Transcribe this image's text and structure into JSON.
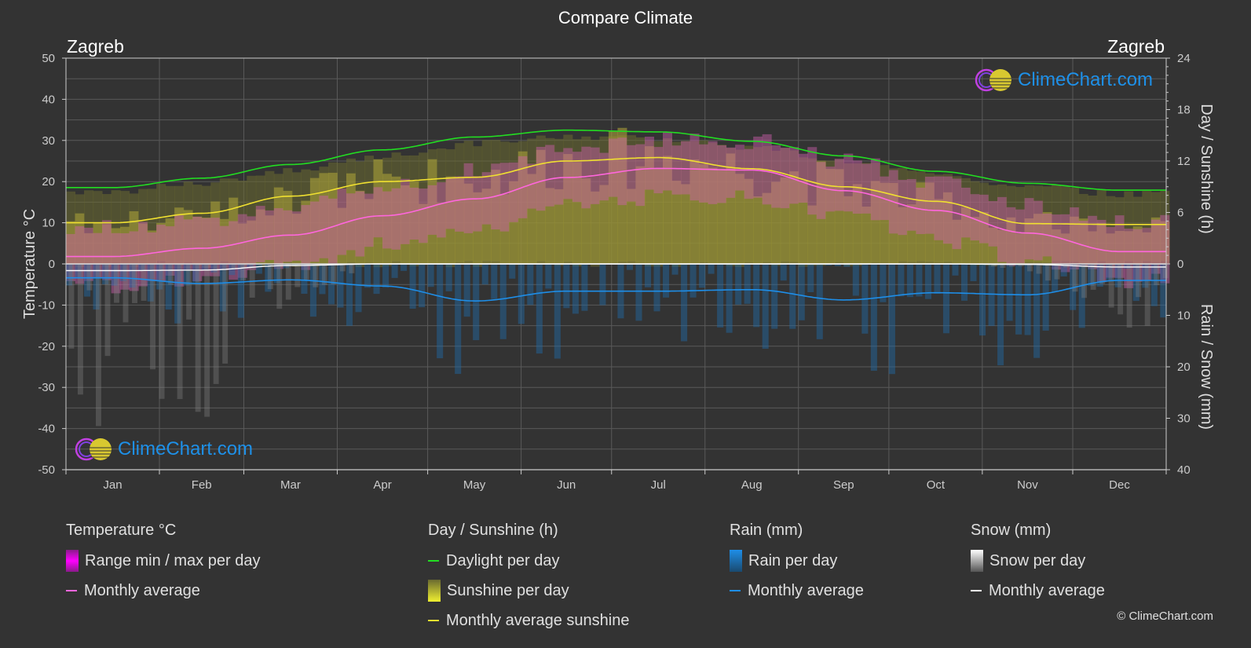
{
  "header": {
    "title": "Compare Climate",
    "city_left": "Zagreb",
    "city_right": "Zagreb"
  },
  "logo": {
    "text": "ClimeChart.com"
  },
  "copyright": "© ClimeChart.com",
  "legend": {
    "temperature": {
      "heading": "Temperature °C",
      "items": [
        {
          "label": "Range min / max per day",
          "kind": "bar",
          "color": "#e020e0"
        },
        {
          "label": "Monthly average",
          "kind": "line",
          "color": "#ff66dd"
        }
      ]
    },
    "sunshine": {
      "heading": "Day / Sunshine (h)",
      "items": [
        {
          "label": "Daylight per day",
          "kind": "line",
          "color": "#22dd22"
        },
        {
          "label": "Sunshine per day",
          "kind": "bar",
          "color": "#e0e030"
        },
        {
          "label": "Monthly average sunshine",
          "kind": "line",
          "color": "#f0e030"
        }
      ]
    },
    "rain": {
      "heading": "Rain (mm)",
      "items": [
        {
          "label": "Rain per day",
          "kind": "bar",
          "color": "#1e8ee8"
        },
        {
          "label": "Monthly average",
          "kind": "line",
          "color": "#1e8ee8"
        }
      ]
    },
    "snow": {
      "heading": "Snow (mm)",
      "items": [
        {
          "label": "Snow per day",
          "kind": "bar",
          "color": "#dddddd"
        },
        {
          "label": "Monthly average",
          "kind": "line",
          "color": "#ffffff"
        }
      ]
    }
  },
  "chart_data": {
    "type": "line",
    "title": "Compare Climate",
    "location": "Zagreb",
    "categories": [
      "Jan",
      "Feb",
      "Mar",
      "Apr",
      "May",
      "Jun",
      "Jul",
      "Aug",
      "Sep",
      "Oct",
      "Nov",
      "Dec"
    ],
    "axes": {
      "left": {
        "label": "Temperature °C",
        "range": [
          -50,
          50
        ],
        "ticks": [
          50,
          40,
          30,
          20,
          10,
          0,
          -10,
          -20,
          -30,
          -40,
          -50
        ]
      },
      "right_top": {
        "label": "Day / Sunshine (h)",
        "range": [
          0,
          24
        ],
        "ticks": [
          24,
          18,
          12,
          6,
          0
        ]
      },
      "right_bottom": {
        "label": "Rain / Snow (mm)",
        "range": [
          0,
          40
        ],
        "ticks": [
          0,
          10,
          20,
          30,
          40
        ]
      }
    },
    "grid": true,
    "series": [
      {
        "name": "Temperature monthly average",
        "unit": "°C",
        "color": "#ff66dd",
        "values": [
          1.8,
          3.8,
          7.0,
          11.7,
          15.8,
          21.0,
          23.2,
          22.8,
          17.8,
          13.0,
          7.5,
          3.0
        ]
      },
      {
        "name": "Daylight per day",
        "unit": "h",
        "color": "#22dd22",
        "values": [
          8.9,
          10.0,
          11.6,
          13.3,
          14.8,
          15.6,
          15.4,
          14.3,
          12.6,
          10.8,
          9.4,
          8.6
        ]
      },
      {
        "name": "Monthly average sunshine",
        "unit": "h",
        "color": "#f0e030",
        "values": [
          4.8,
          5.9,
          7.9,
          9.6,
          10.1,
          12.0,
          12.4,
          11.1,
          9.0,
          7.3,
          4.7,
          4.6
        ]
      },
      {
        "name": "Rain monthly average",
        "unit": "mm",
        "color": "#1e8ee8",
        "values": [
          2.7,
          3.8,
          3.1,
          4.3,
          7.2,
          5.3,
          5.3,
          5.0,
          7.0,
          5.6,
          6.0,
          3.2
        ]
      },
      {
        "name": "Snow monthly average",
        "unit": "mm",
        "color": "#ffffff",
        "values": [
          1.3,
          1.2,
          0.3,
          0.0,
          0.0,
          0.0,
          0.0,
          0.0,
          0.0,
          0.0,
          0.1,
          0.6
        ]
      }
    ]
  }
}
